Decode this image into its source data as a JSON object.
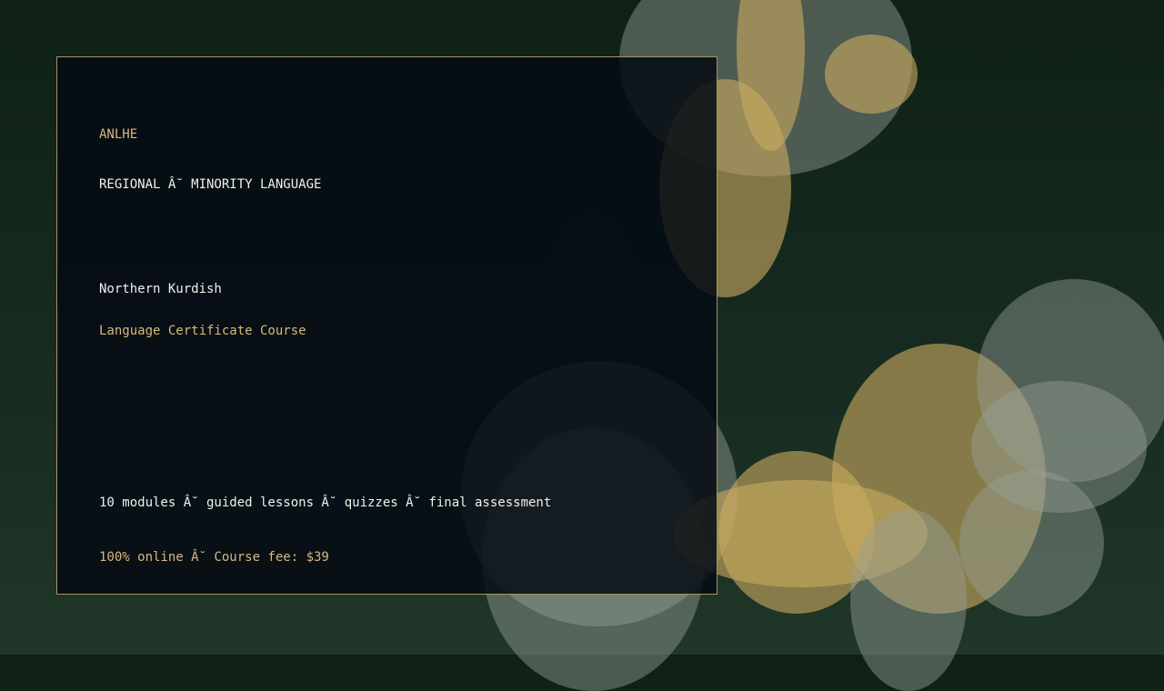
{
  "brand": "ANLHE",
  "category": "REGIONAL Â˘ MINORITY LANGUAGE",
  "language": "Northern Kurdish",
  "subtitle": "Language Certificate Course",
  "details": "10 modules Â˘ guided lessons Â˘ quizzes Â˘ final assessment",
  "pricing": "100% online Â˘ Course fee: $39",
  "colors": {
    "accent_gold": "#d9b97a",
    "text_light": "#f2f0ea",
    "panel_border": "#a8955e",
    "background_green": "#162a1f",
    "panel_background": "#050a14"
  }
}
